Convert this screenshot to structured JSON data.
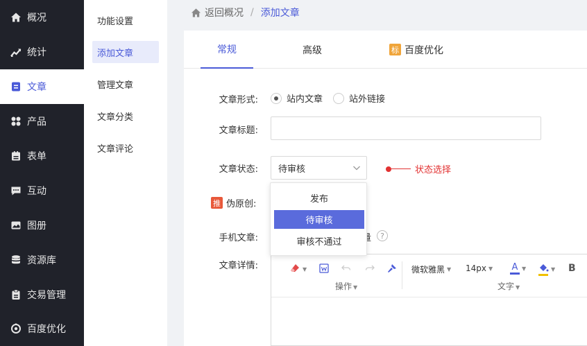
{
  "sidebar": {
    "items": [
      {
        "label": "概况",
        "icon": "home-icon"
      },
      {
        "label": "统计",
        "icon": "chart-icon"
      },
      {
        "label": "文章",
        "icon": "article-icon"
      },
      {
        "label": "产品",
        "icon": "grid-icon"
      },
      {
        "label": "表单",
        "icon": "form-icon"
      },
      {
        "label": "互动",
        "icon": "chat-icon"
      },
      {
        "label": "图册",
        "icon": "image-icon"
      },
      {
        "label": "资源库",
        "icon": "database-icon"
      },
      {
        "label": "交易管理",
        "icon": "clipboard-icon"
      },
      {
        "label": "百度优化",
        "icon": "baidu-icon"
      }
    ]
  },
  "submenu": {
    "items": [
      "功能设置",
      "添加文章",
      "管理文章",
      "文章分类",
      "文章评论"
    ]
  },
  "breadcrumb": {
    "back": "返回概况",
    "separator": "/",
    "current": "添加文章"
  },
  "tabs": [
    {
      "label": "常规"
    },
    {
      "label": "高级"
    },
    {
      "label": "百度优化",
      "badge": "标"
    }
  ],
  "form": {
    "type_label": "文章形式:",
    "type_options": [
      "站内文章",
      "站外链接"
    ],
    "title_label": "文章标题:",
    "title_value": "",
    "status_label": "文章状态:",
    "status_value": "待审核",
    "status_hint": "状态选择",
    "original_badge": "推",
    "original_label": "伪原创:",
    "mobile_label": "手机文章:",
    "mobile_partial": "量",
    "help_mark": "?",
    "detail_label": "文章详情:"
  },
  "dropdown": {
    "options": [
      "发布",
      "待审核",
      "审核不通过"
    ],
    "selected": "待审核"
  },
  "editor": {
    "font_family": "微软雅黑",
    "font_size": "14px",
    "text_color_glyph": "A",
    "bold_glyph": "B",
    "group_ops": "操作",
    "group_text": "文字"
  },
  "colors": {
    "accent": "#4a5ad8",
    "sidebar_bg": "#20222a",
    "hint_red": "#e23232",
    "dropdown_selected": "#5a6bdc",
    "badge_orange": "#f0a53a"
  }
}
